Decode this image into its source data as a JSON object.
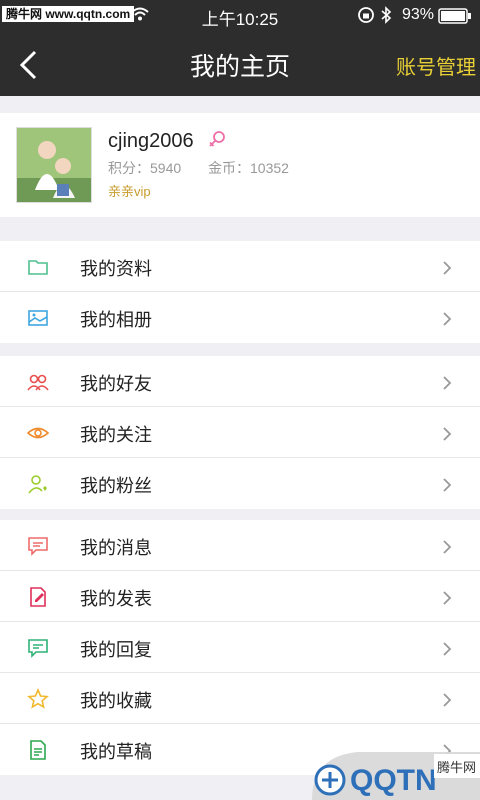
{
  "status_bar": {
    "watermark": "腾牛网 www.qqtn.com",
    "time": "上午10:25",
    "battery": "93%"
  },
  "nav": {
    "title": "我的主页",
    "account_label": "账号管理"
  },
  "profile": {
    "username": "cjing2006",
    "points": "积分：5940",
    "gold": "金币：10352",
    "vip": "亲亲vip"
  },
  "menu_groups": [
    [
      {
        "label": "我的资料",
        "icon": "folder-icon",
        "color": "#4fc08d"
      },
      {
        "label": "我的相册",
        "icon": "photo-icon",
        "color": "#3fa7e0"
      }
    ],
    [
      {
        "label": "我的好友",
        "icon": "friends-icon",
        "color": "#e84e4e"
      },
      {
        "label": "我的关注",
        "icon": "eye-icon",
        "color": "#ef8a2c"
      },
      {
        "label": "我的粉丝",
        "icon": "fans-icon",
        "color": "#9ccc2c"
      }
    ],
    [
      {
        "label": "我的消息",
        "icon": "message-icon",
        "color": "#ee6b6b"
      },
      {
        "label": "我的发表",
        "icon": "post-icon",
        "color": "#e0305a"
      },
      {
        "label": "我的回复",
        "icon": "reply-icon",
        "color": "#2fb277"
      },
      {
        "label": "我的收藏",
        "icon": "star-icon",
        "color": "#f0b92d"
      },
      {
        "label": "我的草稿",
        "icon": "draft-icon",
        "color": "#2ca84f"
      }
    ]
  ],
  "watermark_badge": {
    "logo_text": "QQTN",
    "site": "腾牛网"
  }
}
